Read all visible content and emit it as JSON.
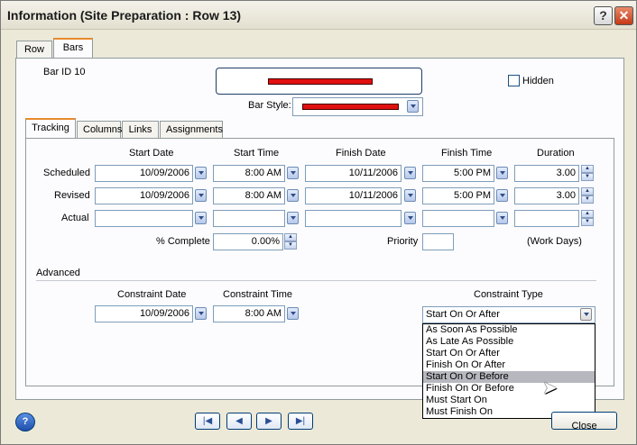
{
  "window": {
    "title": "Information (Site Preparation : Row 13)",
    "help_glyph": "?",
    "close_glyph": "✕"
  },
  "top_tabs": [
    "Row",
    "Bars"
  ],
  "bar_id_label": "Bar ID 10",
  "hidden_label": "Hidden",
  "bar_style_label": "Bar Style:",
  "bar_color": "#e01010",
  "inner_tabs": [
    "Tracking",
    "Columns",
    "Links",
    "Assignments"
  ],
  "columns": {
    "start_date": "Start Date",
    "start_time": "Start Time",
    "finish_date": "Finish Date",
    "finish_time": "Finish Time",
    "duration": "Duration"
  },
  "rows": {
    "scheduled": {
      "label": "Scheduled",
      "start_date": "10/09/2006",
      "start_time": "8:00 AM",
      "finish_date": "10/11/2006",
      "finish_time": "5:00 PM",
      "duration": "3.00"
    },
    "revised": {
      "label": "Revised",
      "start_date": "10/09/2006",
      "start_time": "8:00 AM",
      "finish_date": "10/11/2006",
      "finish_time": "5:00 PM",
      "duration": "3.00"
    },
    "actual": {
      "label": "Actual",
      "start_date": "",
      "start_time": "",
      "finish_date": "",
      "finish_time": "",
      "duration": ""
    }
  },
  "percent_complete": {
    "label": "% Complete",
    "value": "0.00%"
  },
  "priority": {
    "label": "Priority",
    "value": ""
  },
  "work_days": "(Work Days)",
  "advanced": {
    "label": "Advanced",
    "constraint_date_label": "Constraint Date",
    "constraint_date": "10/09/2006",
    "constraint_time_label": "Constraint Time",
    "constraint_time": "8:00 AM",
    "constraint_type_label": "Constraint Type",
    "constraint_type": "Start On Or After",
    "options": [
      "As Soon As Possible",
      "As Late As Possible",
      "Start On Or After",
      "Finish On Or After",
      "Start On Or Before",
      "Finish On Or Before",
      "Must Start On",
      "Must Finish On"
    ],
    "highlighted": "Start On Or Before"
  },
  "footer": {
    "help_glyph": "?",
    "first": "|◀",
    "prev": "◀",
    "next": "▶",
    "last": "▶|",
    "close": "Close"
  }
}
